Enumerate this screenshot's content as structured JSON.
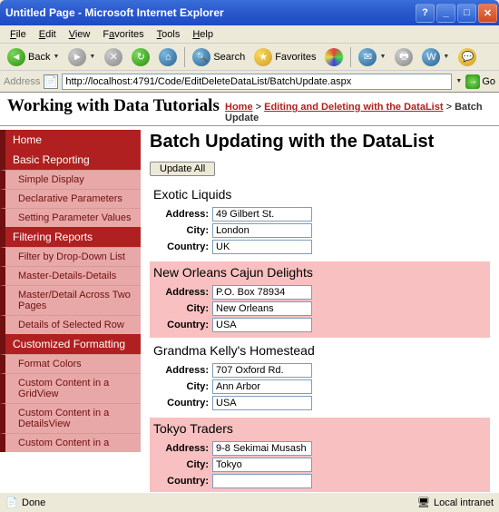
{
  "window": {
    "title": "Untitled Page - Microsoft Internet Explorer"
  },
  "menubar": [
    "File",
    "Edit",
    "View",
    "Favorites",
    "Tools",
    "Help"
  ],
  "toolbar": {
    "back": "Back",
    "search": "Search",
    "favorites": "Favorites"
  },
  "addressbar": {
    "label": "Address",
    "url": "http://localhost:4791/Code/EditDeleteDataList/BatchUpdate.aspx",
    "go": "Go"
  },
  "header": {
    "title": "Working with Data Tutorials",
    "breadcrumb": {
      "home": "Home",
      "sep": " > ",
      "mid": "Editing and Deleting with the DataList",
      "current": "Batch Update"
    }
  },
  "sidebar": [
    {
      "type": "cat",
      "label": "Home"
    },
    {
      "type": "cat",
      "label": "Basic Reporting"
    },
    {
      "type": "item",
      "label": "Simple Display"
    },
    {
      "type": "item",
      "label": "Declarative Parameters"
    },
    {
      "type": "item",
      "label": "Setting Parameter Values"
    },
    {
      "type": "cat",
      "label": "Filtering Reports"
    },
    {
      "type": "item",
      "label": "Filter by Drop-Down List"
    },
    {
      "type": "item",
      "label": "Master-Details-Details"
    },
    {
      "type": "item",
      "label": "Master/Detail Across Two Pages"
    },
    {
      "type": "item",
      "label": "Details of Selected Row"
    },
    {
      "type": "cat",
      "label": "Customized Formatting"
    },
    {
      "type": "item",
      "label": "Format Colors"
    },
    {
      "type": "item",
      "label": "Custom Content in a GridView"
    },
    {
      "type": "item",
      "label": "Custom Content in a DetailsView"
    },
    {
      "type": "item",
      "label": "Custom Content in a"
    }
  ],
  "main": {
    "heading": "Batch Updating with the DataList",
    "updateBtn": "Update All",
    "labels": {
      "address": "Address:",
      "city": "City:",
      "country": "Country:"
    },
    "suppliers": [
      {
        "name": "Exotic Liquids",
        "address": "49 Gilbert St.",
        "city": "London",
        "country": "UK",
        "alt": false
      },
      {
        "name": "New Orleans Cajun Delights",
        "address": "P.O. Box 78934",
        "city": "New Orleans",
        "country": "USA",
        "alt": true
      },
      {
        "name": "Grandma Kelly's Homestead",
        "address": "707 Oxford Rd.",
        "city": "Ann Arbor",
        "country": "USA",
        "alt": false
      },
      {
        "name": "Tokyo Traders",
        "address": "9-8 Sekimai Musash",
        "city": "Tokyo",
        "country": "",
        "alt": true
      }
    ]
  },
  "statusbar": {
    "left": "Done",
    "right": "Local intranet"
  }
}
